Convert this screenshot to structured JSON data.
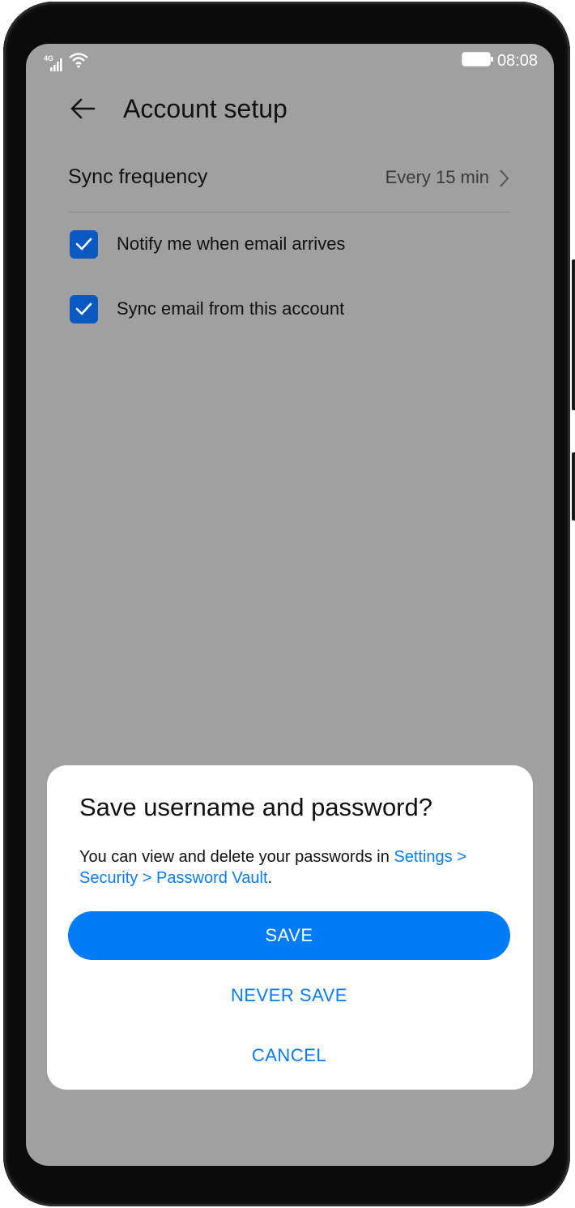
{
  "status_bar": {
    "network_label": "4G",
    "time": "08:08",
    "icons": [
      "signal-icon",
      "wifi-icon",
      "battery-icon"
    ]
  },
  "app_bar": {
    "title": "Account setup",
    "back_icon": "back-arrow-icon"
  },
  "settings": {
    "sync_frequency": {
      "label": "Sync frequency",
      "value": "Every 15 min"
    },
    "checkboxes": [
      {
        "label": "Notify me when email arrives",
        "checked": true
      },
      {
        "label": "Sync email from this account",
        "checked": true
      }
    ]
  },
  "dialog": {
    "title": "Save username and password?",
    "message_prefix": "You can view and delete your passwords in ",
    "message_link": "Settings > Security > Password Vault",
    "message_suffix": ".",
    "save_label": "SAVE",
    "never_save_label": "NEVER SAVE",
    "cancel_label": "CANCEL"
  },
  "colors": {
    "accent": "#007cf8",
    "link": "#0a7cf2",
    "checkbox": "#0a59c3",
    "scrim": "#a0a0a0"
  }
}
